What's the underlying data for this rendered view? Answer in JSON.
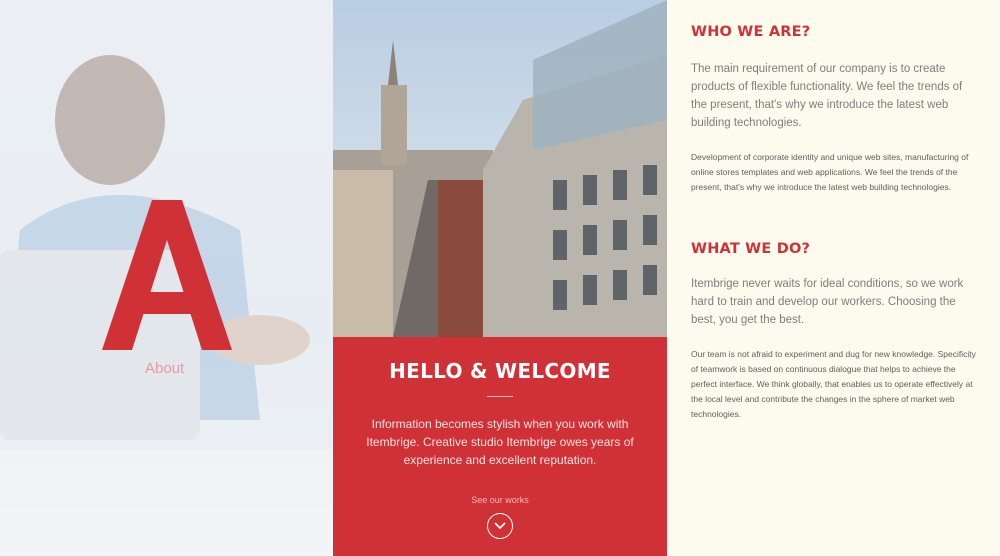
{
  "left": {
    "logo_letter": "A",
    "label": "About"
  },
  "welcome": {
    "title": "HELLO & WELCOME",
    "text": "Information becomes stylish when you work with Itembrige. Creative studio Itembrige owes years of experience and excellent reputation.",
    "link": "See our works"
  },
  "who": {
    "title": "WHO WE ARE?",
    "lead": "The main requirement of our company is to create products of flexible functionality. We feel the trends of the present, that's why we introduce the latest web building technologies.",
    "small": "Development of corporate identity and unique web sites, manufacturing of online stores templates and web applications. We feel the trends of the present, that's why we introduce the latest web building technologies."
  },
  "what": {
    "title": "WHAT WE DO?",
    "lead": "Itembrige never waits for ideal conditions, so we work hard to train and develop our workers. Choosing the best, you get the best.",
    "small": "Our team is not afraid to experiment and dug for new knowledge. Specificity of teamwork is based on continuous dialogue that helps to achieve the perfect interface. We think globally, that enables us to operate effectively at the local level and contribute the changes in the sphere of market web technologies."
  },
  "colors": {
    "accent": "#cf3136",
    "panel_bg": "#fdfbee"
  },
  "icons": {
    "scroll": "chevron-down-icon"
  }
}
